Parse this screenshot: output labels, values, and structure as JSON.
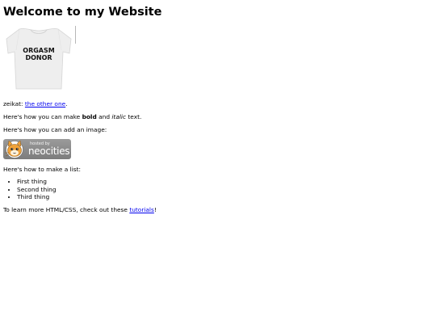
{
  "heading": "Welcome to my Website",
  "shirt": {
    "print_line1": "ORGASM",
    "print_line2": "DONOR"
  },
  "credit": {
    "prefix": "zeikat: ",
    "link": "the other one",
    "suffix": "."
  },
  "formatting": {
    "before": "Here's how you can make ",
    "bold": "bold",
    "middle": " and ",
    "italic": "italic",
    "after": " text."
  },
  "image_intro": "Here's how you can add an image:",
  "badge": {
    "small_text": "hosted by",
    "brand": "neocities"
  },
  "list_intro": "Here's how to make a list:",
  "list_items": [
    "First thing",
    "Second thing",
    "Third thing"
  ],
  "learn": {
    "before": "To learn more HTML/CSS, check out these ",
    "link": "tutorials",
    "after": "!"
  },
  "colors": {
    "link": "#0000ee",
    "badge_bg": "#8a8a8a",
    "cat_orange": "#f0a23a"
  }
}
